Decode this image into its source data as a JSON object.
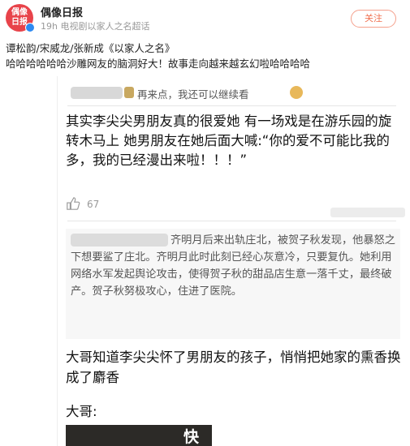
{
  "header": {
    "avatar_text": "偶像日报",
    "username": "偶像日报",
    "meta": "19h 电视剧以家人之名超话",
    "follow_label": "关注"
  },
  "post": {
    "line1": "谭松韵/宋威龙/张新成《以家人之名》",
    "line2": "哈哈哈哈哈哈沙雕网友的脑洞好大！故事走向越来越玄幻啦哈哈哈哈"
  },
  "screenshot": {
    "reply_text": "再来点，我还可以继续看",
    "comment1": "其实李尖尖男朋友真的很爱她 有一场戏是在游乐园的旋转木马上 她男朋友在她后面大喊:“你的爱不可能比我的多，我的已经漫出来啦！！！”",
    "like_count": "67",
    "quote_text": "齐明月后来出轨庄北，被贺子秋发现，他暴怒之下想要鲨了庄北。齐明月此时此刻已经心灰意冷，只要复仇。她利用网络水军发起舆论攻击，使得贺子秋的甜品店生意一落千丈，最终破产。贺子秋努极攻心，住进了医院。",
    "comment2": "大哥知道李尖尖怀了男朋友的孩子，悄悄把她家的熏香换成了麝香",
    "dage_label": "大哥:",
    "video_label": "快"
  },
  "colors": {
    "accent": "#f07050",
    "avatar_bg": "#e8434a",
    "verify": "#2e8af1"
  }
}
